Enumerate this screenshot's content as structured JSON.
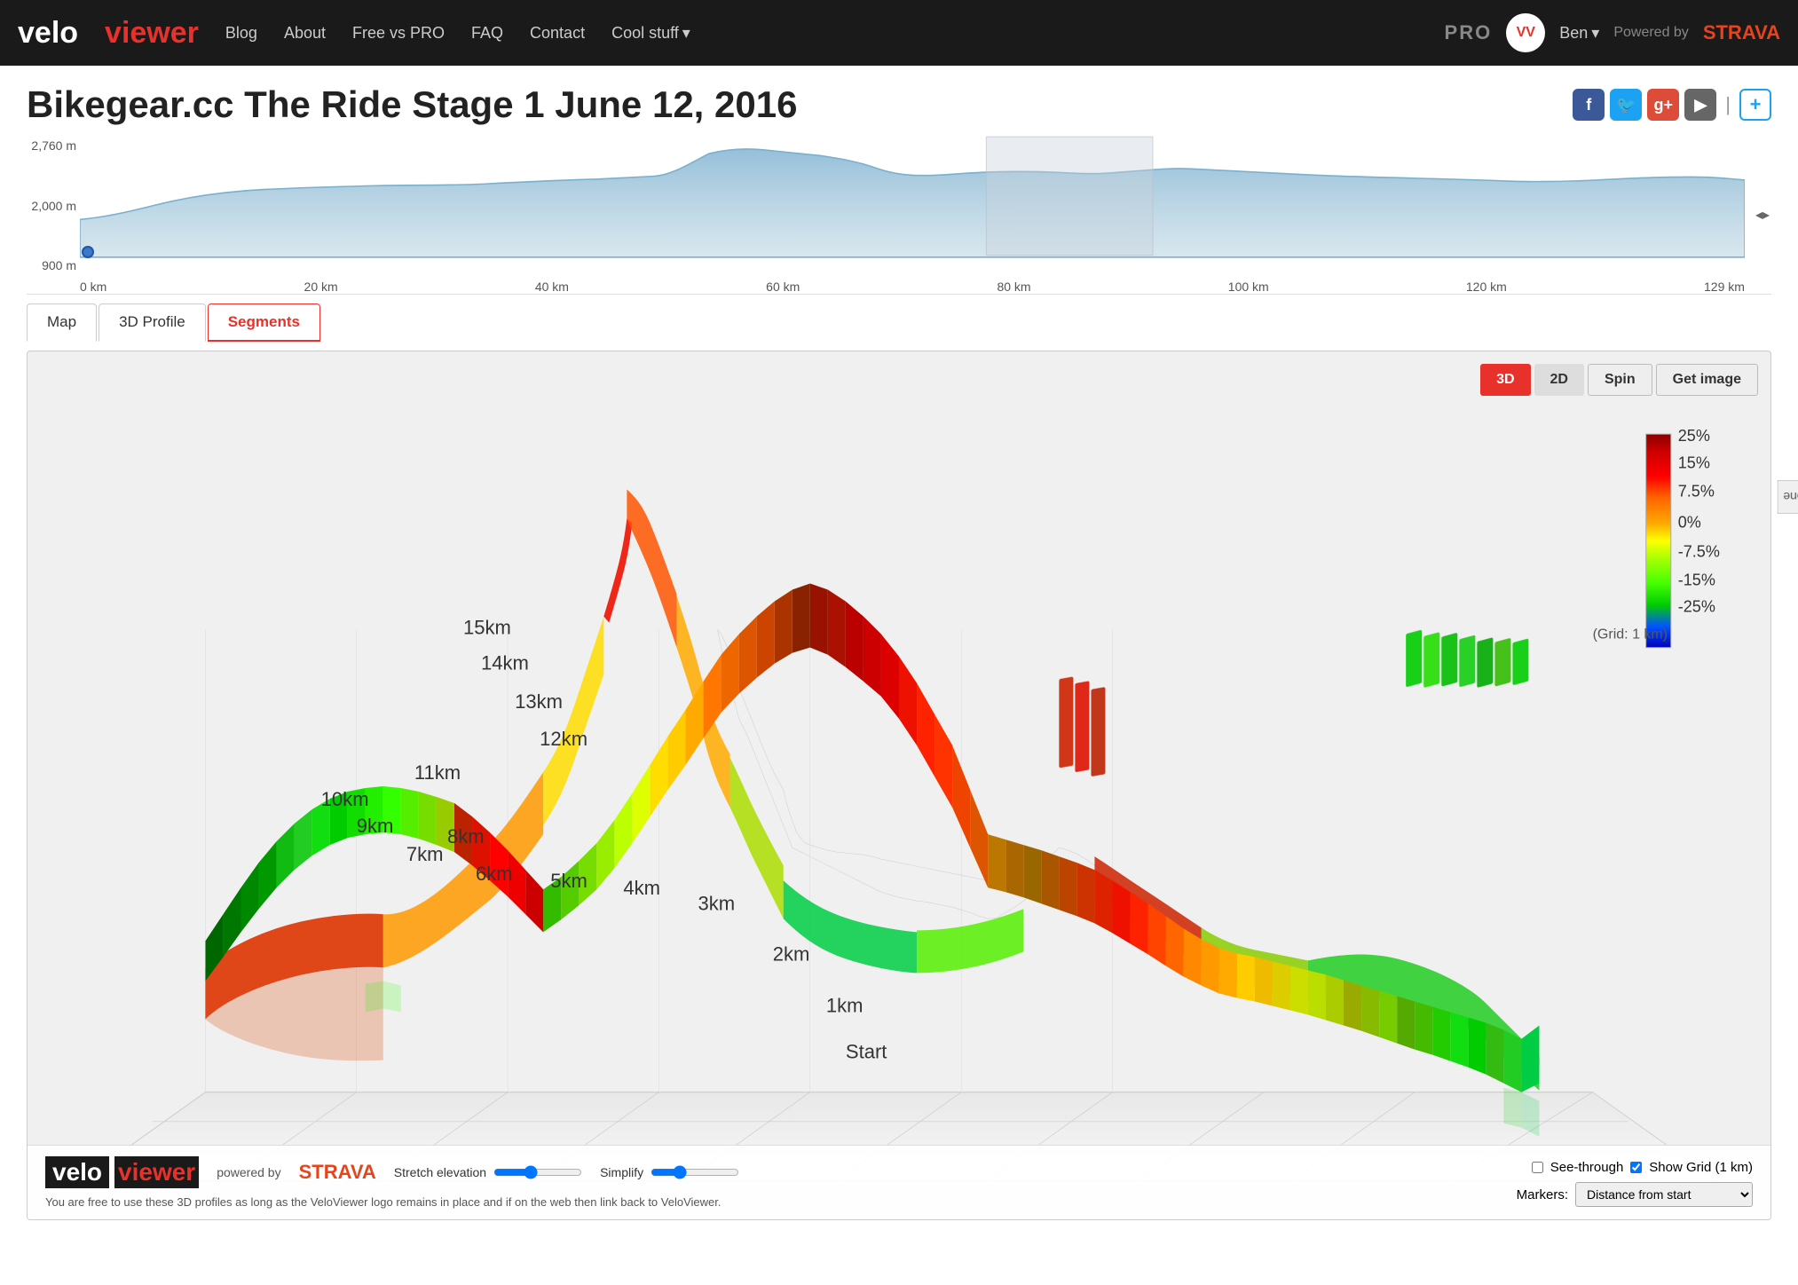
{
  "navbar": {
    "logo_velo": "velo",
    "logo_viewer": "viewer",
    "links": [
      "Blog",
      "About",
      "Free vs PRO",
      "FAQ",
      "Contact"
    ],
    "cool_stuff": "Cool stuff",
    "pro_label": "PRO",
    "user_label": "Ben",
    "powered_label": "Powered by",
    "strava_label": "STRAVA"
  },
  "page": {
    "title": "Bikegear.cc The Ride Stage 1 June 12, 2016"
  },
  "elevation": {
    "y_labels": [
      "2,760 m",
      "2,000 m",
      "900 m"
    ],
    "x_labels": [
      "0 km",
      "20 km",
      "40 km",
      "60 km",
      "80 km",
      "100 km",
      "120 km",
      "129 km"
    ]
  },
  "tabs": [
    {
      "label": "Map",
      "active": false
    },
    {
      "label": "3D Profile",
      "active": false
    },
    {
      "label": "Segments",
      "active": true
    }
  ],
  "toolbar": {
    "btn_3d": "3D",
    "btn_2d": "2D",
    "btn_spin": "Spin",
    "btn_get_image": "Get image"
  },
  "km_labels": [
    "15km",
    "14km",
    "13km",
    "12km",
    "11km",
    "10km",
    "9km",
    "8km",
    "7km",
    "6km",
    "5km",
    "4km",
    "3km",
    "2km",
    "1km",
    "Start"
  ],
  "legend": {
    "labels": [
      "25%",
      "15%",
      "7.5%",
      "0%",
      "-7.5%",
      "-15%",
      "-25%"
    ],
    "grid_note": "(Grid: 1 km)"
  },
  "bottom": {
    "powered_by": "powered by",
    "strava": "STRAVA",
    "stretch_label": "Stretch elevation",
    "simplify_label": "Simplify",
    "disclaimer": "You are free to use these 3D profiles as long as the VeloViewer logo remains in place and if on the web then link back to VeloViewer.",
    "see_through_label": "See-through",
    "show_grid_label": "Show Grid (1 km)",
    "markers_label": "Markers:",
    "markers_value": "Distance from start"
  },
  "sidebar": {
    "label": "None"
  }
}
